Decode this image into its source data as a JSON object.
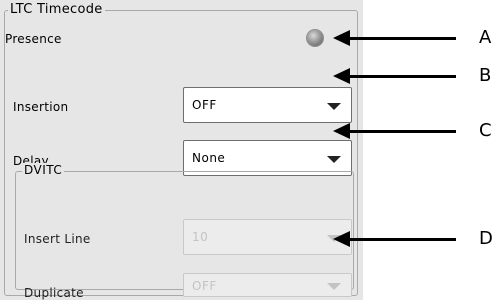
{
  "panel": {
    "group_title": "LTC Timecode",
    "presence_label": "Presence",
    "insertion_label": "Insertion",
    "insertion_value": "OFF",
    "delay_label": "Delay",
    "delay_value": "None",
    "dvitc_title": "DVITC",
    "insert_line_label": "Insert Line",
    "insert_line_value": "10",
    "duplicate_label": "Duplicate",
    "duplicate_value": "OFF"
  },
  "callouts": [
    "A",
    "B",
    "C",
    "D"
  ],
  "colors": {
    "panel_bg": "#e6e6e6",
    "led_gray": "#9a9a9a",
    "disabled_text": "#c3c3c3"
  }
}
